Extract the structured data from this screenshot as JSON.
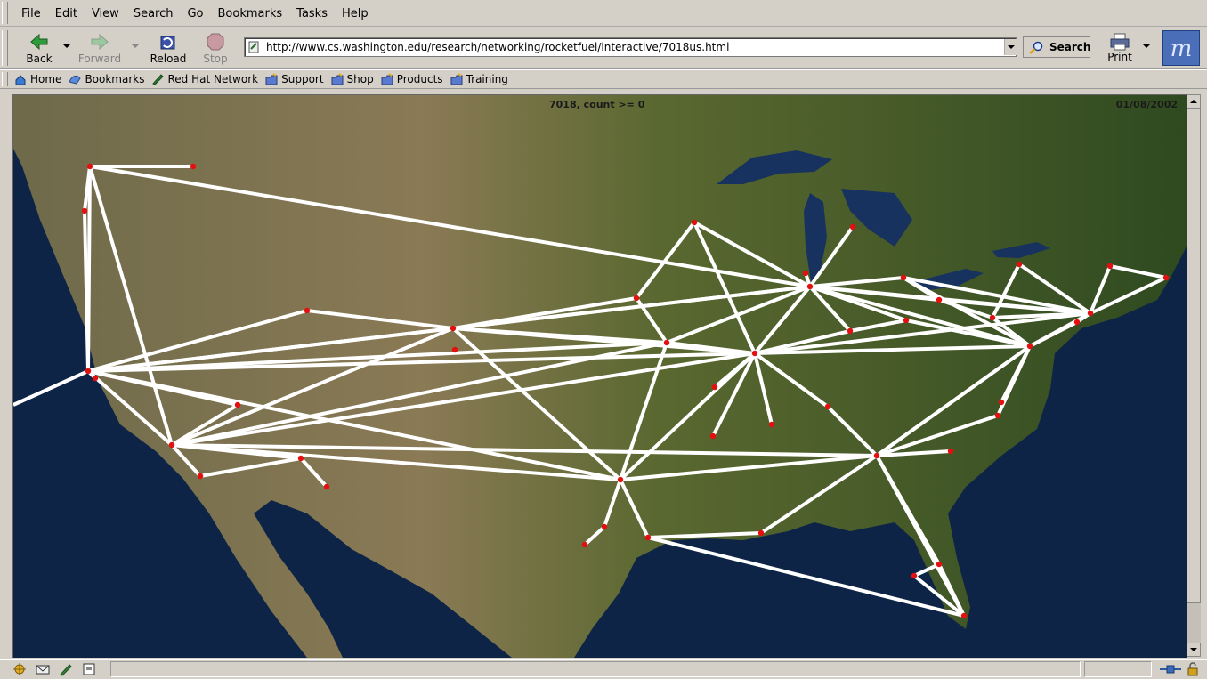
{
  "menu": {
    "items": [
      {
        "label": "File",
        "key": "F"
      },
      {
        "label": "Edit",
        "key": "E"
      },
      {
        "label": "View",
        "key": "V"
      },
      {
        "label": "Search",
        "key": "S"
      },
      {
        "label": "Go",
        "key": "G"
      },
      {
        "label": "Bookmarks",
        "key": "B"
      },
      {
        "label": "Tasks",
        "key": "T"
      },
      {
        "label": "Help",
        "key": "H"
      }
    ]
  },
  "nav": {
    "back": "Back",
    "forward": "Forward",
    "reload": "Reload",
    "stop": "Stop",
    "url": "http://www.cs.washington.edu/research/networking/rocketfuel/interactive/7018us.html",
    "search": "Search",
    "print": "Print"
  },
  "personal": {
    "items": [
      {
        "label": "Home",
        "icon": "home-icon"
      },
      {
        "label": "Bookmarks",
        "icon": "bookmarks-icon"
      },
      {
        "label": "Red Hat Network",
        "icon": "redhat-network-icon"
      },
      {
        "label": "Support",
        "icon": "folder-icon"
      },
      {
        "label": "Shop",
        "icon": "folder-icon"
      },
      {
        "label": "Products",
        "icon": "folder-icon"
      },
      {
        "label": "Training",
        "icon": "folder-icon"
      }
    ]
  },
  "map": {
    "caption": "7018, count >= 0",
    "date": "01/08/2002"
  },
  "colors": {
    "chrome": "#d4d0c8",
    "link": "#ffffff",
    "node": "#e41010",
    "land": "#4b5a2a",
    "ocean": "#0d2446"
  }
}
